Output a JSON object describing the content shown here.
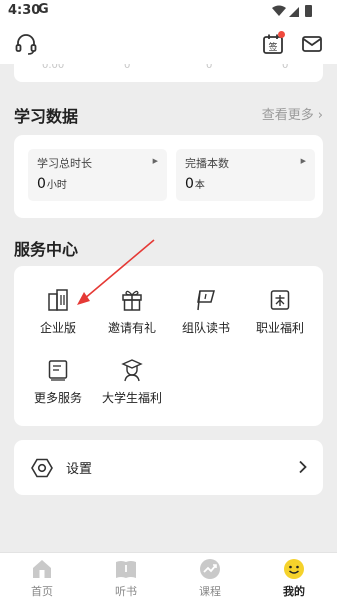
{
  "status_bar": {
    "time": "4:30",
    "carrier_icon": "G"
  },
  "header": {
    "left_icon": "headset-icon",
    "right_icons": [
      "calendar-sign-icon",
      "mail-icon"
    ],
    "calendar_char": "签"
  },
  "study": {
    "title": "学习数据",
    "more": "查看更多",
    "stats": [
      {
        "label": "学习总时长",
        "value": "0",
        "unit": "小时"
      },
      {
        "label": "完播本数",
        "value": "0",
        "unit": "本"
      }
    ]
  },
  "services": {
    "title": "服务中心",
    "items": [
      {
        "label": "企业版",
        "icon": "building-icon"
      },
      {
        "label": "邀请有礼",
        "icon": "gift-icon"
      },
      {
        "label": "组队读书",
        "icon": "flag-icon"
      },
      {
        "label": "职业福利",
        "icon": "badge-icon"
      },
      {
        "label": "更多服务",
        "icon": "book-open-icon"
      },
      {
        "label": "大学生福利",
        "icon": "graduate-icon"
      }
    ]
  },
  "settings": {
    "label": "设置"
  },
  "tabbar": {
    "tabs": [
      {
        "label": "首页",
        "icon": "home-icon",
        "active": false
      },
      {
        "label": "听书",
        "icon": "book-icon",
        "active": false
      },
      {
        "label": "课程",
        "icon": "course-icon",
        "active": false
      },
      {
        "label": "我的",
        "icon": "smile-icon",
        "active": true
      }
    ]
  },
  "colors": {
    "accent": "#f5d22b",
    "annotation": "#e53935",
    "badge": "#f04a3e"
  }
}
